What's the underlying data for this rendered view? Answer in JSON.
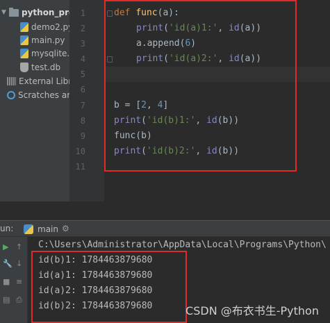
{
  "colors": {
    "keyword": "#cc7832",
    "function_name": "#ffc66d",
    "string": "#6a8759",
    "number": "#6897bb",
    "builtin": "#8888c6",
    "highlight_box": "#e32a2a"
  },
  "project": {
    "root": "python_pro",
    "files": [
      "demo2.py",
      "main.py",
      "mysqlite.",
      "test.db"
    ],
    "external_libraries": "External Libr",
    "scratches": "Scratches ar"
  },
  "editor": {
    "line_numbers": [
      "1",
      "2",
      "3",
      "4",
      "5",
      "6",
      "7",
      "8",
      "9",
      "10",
      "11"
    ],
    "lines": {
      "l1": {
        "kw": "def",
        "name": "func",
        "rest": "(a):"
      },
      "l2": {
        "builtin": "print",
        "open": "(",
        "str": "'id(a)1:'",
        "rest": ", ",
        "builtin2": "id",
        "end": "(a))"
      },
      "l3": {
        "pre": "a.append(",
        "num": "6",
        "end": ")"
      },
      "l4": {
        "builtin": "print",
        "open": "(",
        "str": "'id(a)2:'",
        "rest": ", ",
        "builtin2": "id",
        "end": "(a))"
      },
      "l7": {
        "pre": "b = [",
        "num1": "2",
        "mid": ", ",
        "num2": "4",
        "end": "]"
      },
      "l8": {
        "builtin": "print",
        "open": "(",
        "str": "'id(b)1:'",
        "rest": ", ",
        "builtin2": "id",
        "end": "(b))"
      },
      "l9": {
        "text": "func(b)"
      },
      "l10": {
        "builtin": "print",
        "open": "(",
        "str": "'id(b)2:'",
        "rest": ", ",
        "builtin2": "id",
        "end": "(b))"
      }
    }
  },
  "run": {
    "label": "un:",
    "tab": "main",
    "settings_icon": "gear-icon",
    "path": "C:\\Users\\Administrator\\AppData\\Local\\Programs\\Python\\",
    "output": [
      "id(b)1: 1784463879680",
      "id(a)1: 1784463879680",
      "id(a)2: 1784463879680",
      "id(b)2: 1784463879680"
    ]
  },
  "watermark": "CSDN @布衣书生-Python"
}
